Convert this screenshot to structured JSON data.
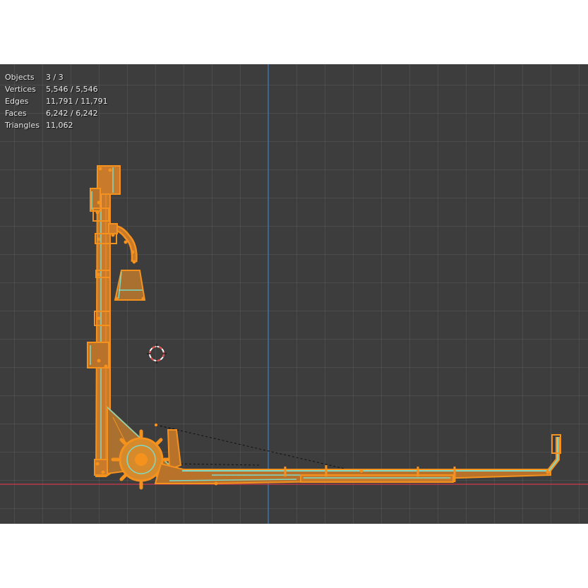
{
  "app": "Blender 3D Viewport",
  "statistics": [
    {
      "label": "Objects",
      "value": "3 / 3"
    },
    {
      "label": "Vertices",
      "value": "5,546 / 5,546"
    },
    {
      "label": "Edges",
      "value": "11,791 / 11,791"
    },
    {
      "label": "Faces",
      "value": "6,242 / 6,242"
    },
    {
      "label": "Triangles",
      "value": "11,062"
    }
  ],
  "colors": {
    "viewport_bg": "#3d3d3d",
    "selection_orange": "#f5921e",
    "selection_fill": "#c97a2a",
    "edge_highlight": "#7ddac8",
    "x_axis": "#b73a48",
    "z_axis": "#3f6fa8",
    "cursor_red": "#e84a4a",
    "cursor_white": "#ffffff"
  },
  "icons": {
    "cursor": "3d-cursor-icon"
  }
}
